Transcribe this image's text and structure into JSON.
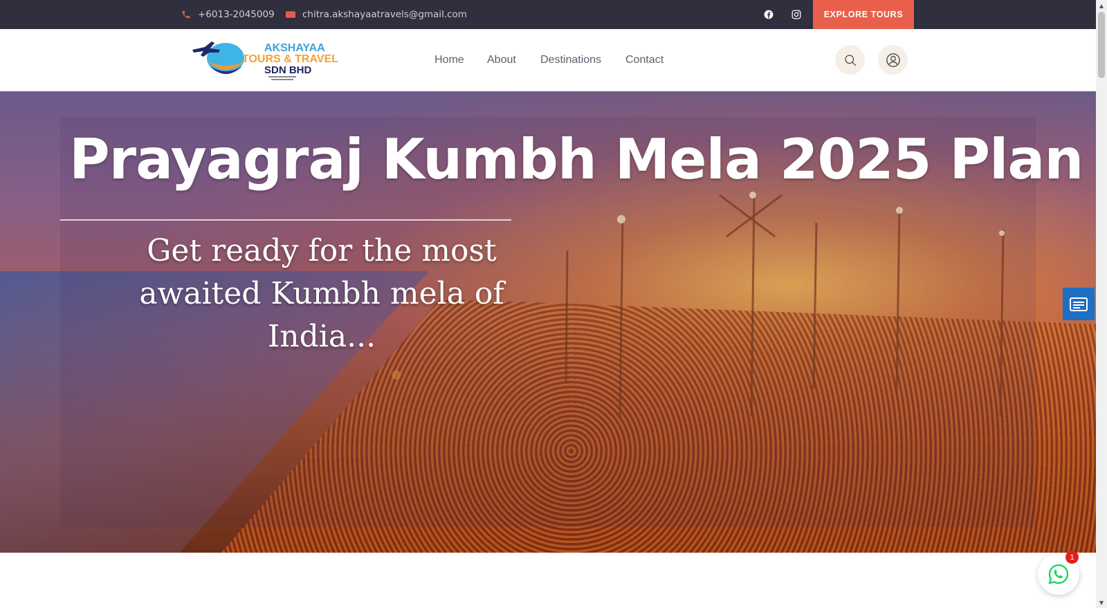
{
  "topbar": {
    "phone": "+6013-2045009",
    "email": "chitra.akshayaatravels@gmail.com",
    "explore_label": "EXPLORE TOURS",
    "accent_color": "#e8604c"
  },
  "logo": {
    "line1": "AKSHAYAA",
    "line2": "TOURS & TRAVEL",
    "line3": "SDN BHD"
  },
  "nav": {
    "items": [
      {
        "label": "Home"
      },
      {
        "label": "About"
      },
      {
        "label": "Destinations"
      },
      {
        "label": "Contact"
      }
    ]
  },
  "hero": {
    "title": "Prayagraj Kumbh Mela 2025 Plan",
    "subtitle": "Get ready for the most awaited Kumbh mela of India..."
  },
  "whatsapp": {
    "badge_count": "1"
  },
  "icons": [
    "phone-icon",
    "mail-icon",
    "facebook-icon",
    "instagram-icon",
    "search-icon",
    "user-icon",
    "form-icon",
    "whatsapp-icon"
  ]
}
